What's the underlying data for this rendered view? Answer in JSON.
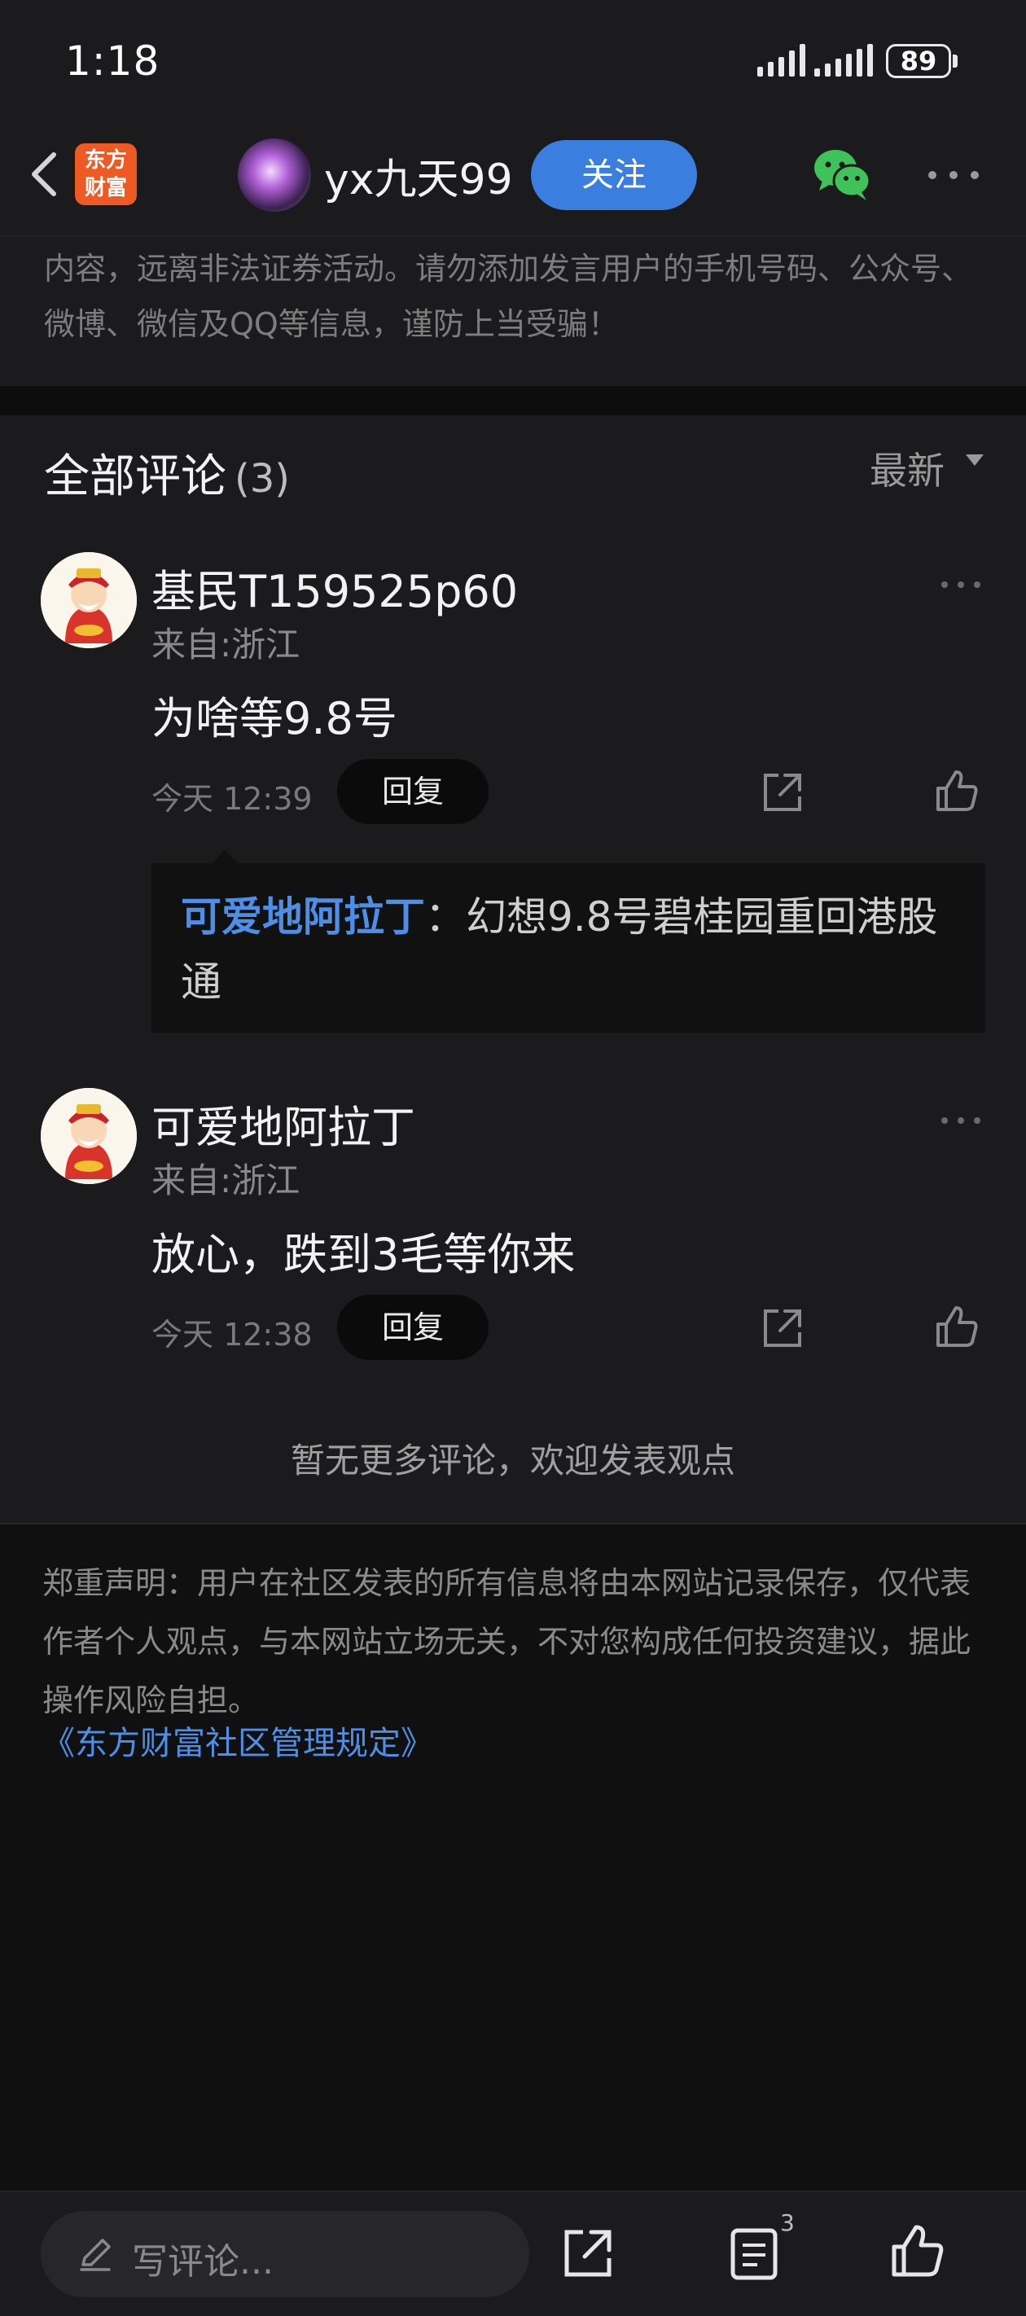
{
  "status_bar": {
    "time": "1:18",
    "battery": "89"
  },
  "nav": {
    "logo_text": "东方\n财富",
    "author_name": "yx九天99",
    "follow_label": "关注",
    "icons": [
      "back-arrow-icon",
      "wechat-icon",
      "more-icon"
    ]
  },
  "warning": {
    "text": "内容，远离非法证券活动。请勿添加发言用户的手机号码、公众号、微博、微信及QQ等信息，谨防上当受骗！"
  },
  "comments": {
    "title": "全部评论",
    "count": "(3)",
    "sort_label": "最新",
    "items": [
      {
        "name": "基民T159525p60",
        "location": "来自:浙江",
        "body": "为啥等9.8号",
        "time": "今天 12:39",
        "reply_label": "回复"
      },
      {
        "name": "可爱地阿拉丁",
        "location": "来自:浙江",
        "body": "放心，跌到3毛等你来",
        "time": "今天 12:38",
        "reply_label": "回复"
      }
    ],
    "reply": {
      "author": "可爱地阿拉丁",
      "text": "：幻想9.8号碧桂园重回港股通"
    },
    "no_more": "暂无更多评论，欢迎发表观点"
  },
  "disclaimer": {
    "text": "郑重声明：用户在社区发表的所有信息将由本网站记录保存，仅代表作者个人观点，与本网站立场无关，不对您构成任何投资建议，据此操作风险自担。",
    "link": "《东方财富社区管理规定》"
  },
  "bottom_bar": {
    "placeholder": "写评论...",
    "list_count": "3"
  },
  "colors": {
    "accent_blue": "#3a7ee0",
    "link_blue": "#4d8fe6",
    "logo_orange": "#ee5a24",
    "background": "#1b1b1d"
  }
}
